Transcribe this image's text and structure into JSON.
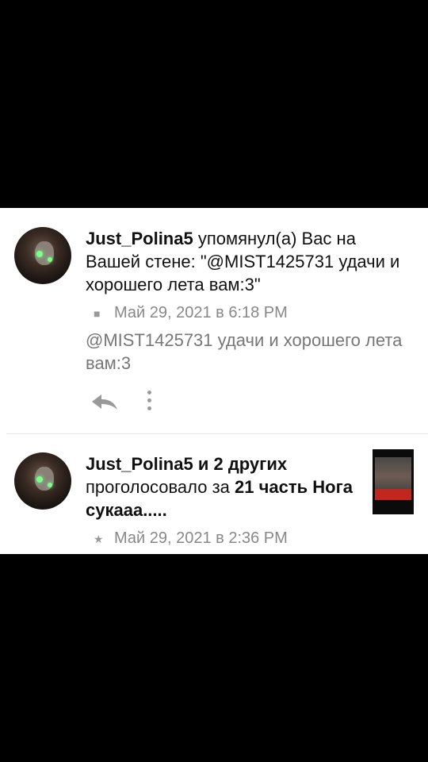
{
  "notifications": [
    {
      "user": "Just_Polina5",
      "action": " упомянул(а) Вас на Вашей стене: \"@MIST1425731 удачи и хорошего лета вам:3\"",
      "meta_icon": "comment-icon",
      "timestamp": "Май 29, 2021 в 6:18 PM",
      "body": "@MIST1425731 удачи и хорошего лета вам:3"
    },
    {
      "user": "Just_Polina5",
      "others": " и 2 других",
      "action": " проголосовало за ",
      "target": "21 часть Нога сукааа.....",
      "meta_icon": "star-icon",
      "timestamp": "Май 29, 2021 в 2:36 PM"
    }
  ]
}
